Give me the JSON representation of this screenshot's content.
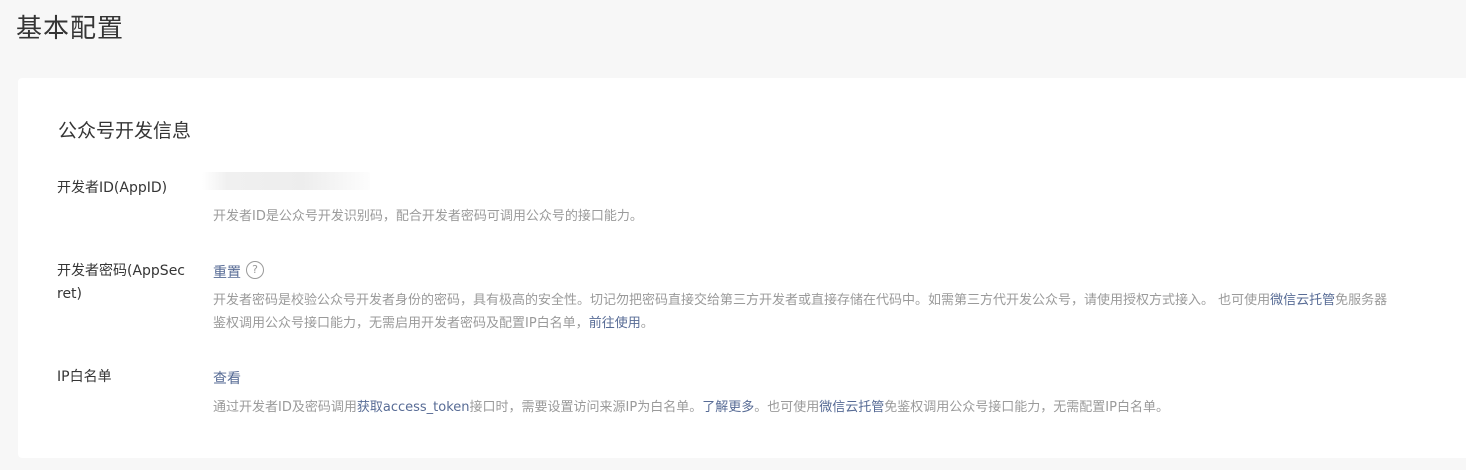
{
  "page": {
    "title": "基本配置"
  },
  "section": {
    "title": "公众号开发信息"
  },
  "app_id": {
    "label": "开发者ID(AppID)",
    "desc": "开发者ID是公众号开发识别码，配合开发者密码可调用公众号的接口能力。"
  },
  "app_secret": {
    "label": "开发者密码(AppSecret)",
    "reset_label": "重置",
    "help_icon": "?",
    "desc_line1_a": "开发者密码是校验公众号开发者身份的密码，具有极高的安全性。切记勿把密码直接交给第三方开发者或直接存储在代码中。如需第三方代开发公众号，请使用授权方式接入。 也可使用",
    "desc_line1_link": "微信云托管",
    "desc_line1_b": "免服务器",
    "desc_line2_a": "鉴权调用公众号接口能力，无需启用开发者密码及配置IP白名单，",
    "desc_line2_link": "前往使用",
    "desc_line2_b": "。"
  },
  "ip_whitelist": {
    "label": "IP白名单",
    "view_label": "查看",
    "desc_a": "通过开发者ID及密码调用",
    "desc_link1": "获取access_token",
    "desc_b": "接口时，需要设置访问来源IP为白名单。",
    "desc_link2": "了解更多",
    "desc_c": "。也可使用",
    "desc_link3": "微信云托管",
    "desc_d": "免鉴权调用公众号接口能力，无需配置IP白名单。"
  },
  "colors": {
    "link": "#576b95",
    "muted": "#9a9a9a",
    "text": "#353535"
  }
}
